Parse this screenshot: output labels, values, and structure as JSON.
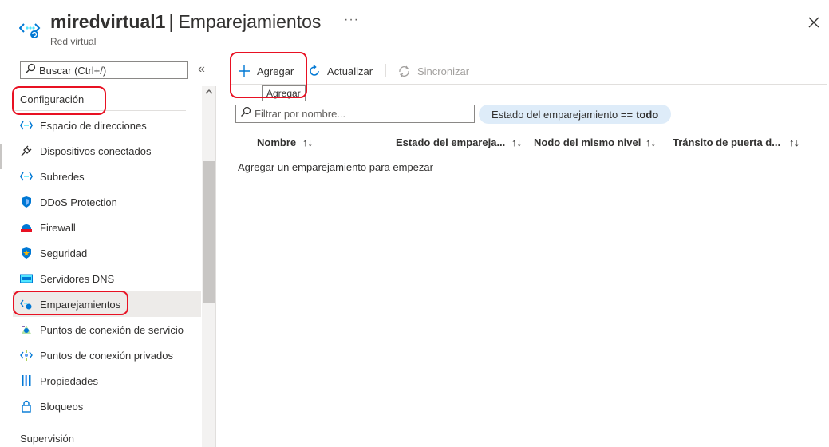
{
  "header": {
    "resource_name": "miredvirtual1",
    "separator": "|",
    "page_title": "Emparejamientos",
    "subtitle": "Red virtual",
    "more_label": "···",
    "resource_icon": "virtual-network-icon",
    "close_icon": "close-icon"
  },
  "sidebar": {
    "search_placeholder": "Buscar (Ctrl+/)",
    "collapse_label": "«",
    "section_title": "Configuración",
    "items": [
      {
        "label": "Espacio de direcciones",
        "icon": "address-space-icon"
      },
      {
        "label": "Dispositivos conectados",
        "icon": "plug-icon"
      },
      {
        "label": "Subredes",
        "icon": "subnet-icon"
      },
      {
        "label": "DDoS Protection",
        "icon": "shield-icon"
      },
      {
        "label": "Firewall",
        "icon": "firewall-icon"
      },
      {
        "label": "Seguridad",
        "icon": "security-shield-icon"
      },
      {
        "label": "Servidores DNS",
        "icon": "dns-server-icon"
      },
      {
        "label": "Emparejamientos",
        "icon": "peering-icon"
      },
      {
        "label": "Puntos de conexión de servicio",
        "icon": "service-endpoint-icon"
      },
      {
        "label": "Puntos de conexión privados",
        "icon": "private-endpoint-icon"
      },
      {
        "label": "Propiedades",
        "icon": "properties-icon"
      },
      {
        "label": "Bloqueos",
        "icon": "lock-icon"
      }
    ],
    "active_index": 7,
    "next_section_title": "Supervisión"
  },
  "toolbar": {
    "add_label": "Agregar",
    "refresh_label": "Actualizar",
    "sync_label": "Sincronizar",
    "tooltip": "Agregar"
  },
  "filter": {
    "placeholder": "Filtrar por nombre...",
    "pill_prefix": "Estado del emparejamiento ==",
    "pill_value": "todo"
  },
  "table": {
    "columns": [
      "Nombre",
      "Estado del empareja...",
      "Nodo del mismo nivel",
      "Tránsito de puerta d..."
    ],
    "sort_glyph": "↑↓",
    "empty_message": "Agregar un emparejamiento para empezar"
  },
  "colors": {
    "accent": "#0078d4",
    "annotation_red": "#e81123",
    "active_row": "#edebe9",
    "pill_bg": "#deecf9"
  }
}
